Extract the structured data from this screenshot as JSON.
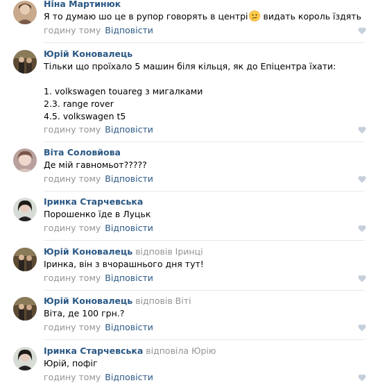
{
  "comments": [
    {
      "author": "Ніна Мартинюк",
      "reply_to": "",
      "text_before": "Я то думаю шо це в рупор говорять в центрі",
      "text_after": " видать король їздять",
      "emoji": "confused-face-icon",
      "time": "годину тому",
      "reply": "Відповісти"
    },
    {
      "author": "Юрій Коновалець",
      "reply_to": "",
      "lines": [
        "Тільки що проїхало 5 машин біля кільця, як до Епіцентра їхати:",
        "",
        "1. volkswagen touareg з мигалками",
        "2.3. range rover",
        "4.5. volkswagen t5"
      ],
      "time": "годину тому",
      "reply": "Відповісти"
    },
    {
      "author": "Віта Соловйова",
      "reply_to": "",
      "text": "Де мій гавномьот?????",
      "time": "годину тому",
      "reply": "Відповісти"
    },
    {
      "author": "Іринка Старчевська",
      "reply_to": "",
      "text": "Порошенко їде в Луцьк",
      "time": "годину тому",
      "reply": "Відповісти"
    },
    {
      "author": "Юрій Коновалець",
      "reply_to": "відповів Іринці",
      "text": "Іринка, він з вчорашнього дня тут!",
      "time": "годину тому",
      "reply": "Відповісти"
    },
    {
      "author": "Юрій Коновалець",
      "reply_to": "відповів Віті",
      "text": "Віта, де 100 грн.?",
      "time": "годину тому",
      "reply": "Відповісти"
    },
    {
      "author": "Іринка Старчевська",
      "reply_to": "відповіла Юрію",
      "text": "Юрій, пофіг",
      "time": "годину тому",
      "reply": "Відповісти"
    }
  ],
  "colors": {
    "link": "#2a5885",
    "muted": "#939393",
    "divider": "#e7e8ec",
    "like_icon": "#c5d0db"
  },
  "icons": {
    "like": "heart-icon"
  }
}
